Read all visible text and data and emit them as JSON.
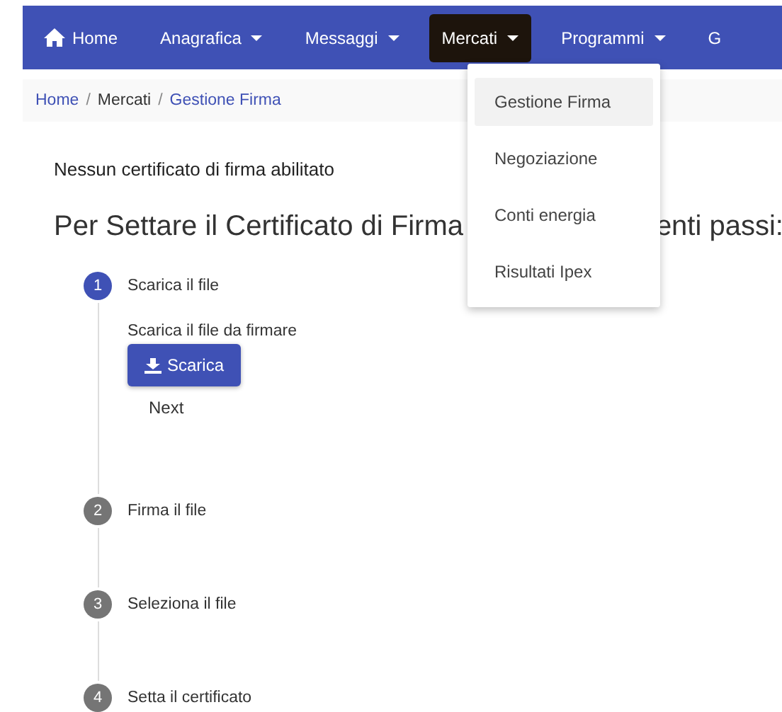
{
  "navbar": {
    "items": [
      {
        "label": "Home",
        "kind": "home",
        "selected": false
      },
      {
        "label": "Anagrafica",
        "kind": "dropdown",
        "selected": false
      },
      {
        "label": "Messaggi",
        "kind": "dropdown",
        "selected": false
      },
      {
        "label": "Mercati",
        "kind": "dropdown",
        "selected": true
      },
      {
        "label": "Programmi",
        "kind": "dropdown",
        "selected": false
      },
      {
        "label": "G",
        "kind": "cut",
        "selected": false
      }
    ]
  },
  "breadcrumb": [
    {
      "label": "Home",
      "kind": "link"
    },
    {
      "label": "/",
      "kind": "separator"
    },
    {
      "label": "Mercati",
      "kind": "text"
    },
    {
      "label": "/",
      "kind": "separator"
    },
    {
      "label": "Gestione Firma",
      "kind": "link"
    }
  ],
  "dropdown_menu": {
    "items": [
      {
        "label": "Gestione Firma",
        "selected": true
      },
      {
        "label": "Negoziazione",
        "selected": false
      },
      {
        "label": "Conti energia",
        "selected": false
      },
      {
        "label": "Risultati Ipex",
        "selected": false
      }
    ]
  },
  "notice": "Nessun certificato di firma abilitato",
  "heading": {
    "visible_start": "Per Settare il Certificato di Firma",
    "visible_end": "enti passi:"
  },
  "steps": [
    {
      "number": "1",
      "label": "Scarica il file",
      "selected": true,
      "content": {
        "text": "Scarica il file da firmare",
        "button": "Scarica",
        "next": "Next"
      }
    },
    {
      "number": "2",
      "label": "Firma il file",
      "selected": false
    },
    {
      "number": "3",
      "label": "Seleziona il file",
      "selected": false
    },
    {
      "number": "4",
      "label": "Setta il certificato",
      "selected": false
    }
  ]
}
